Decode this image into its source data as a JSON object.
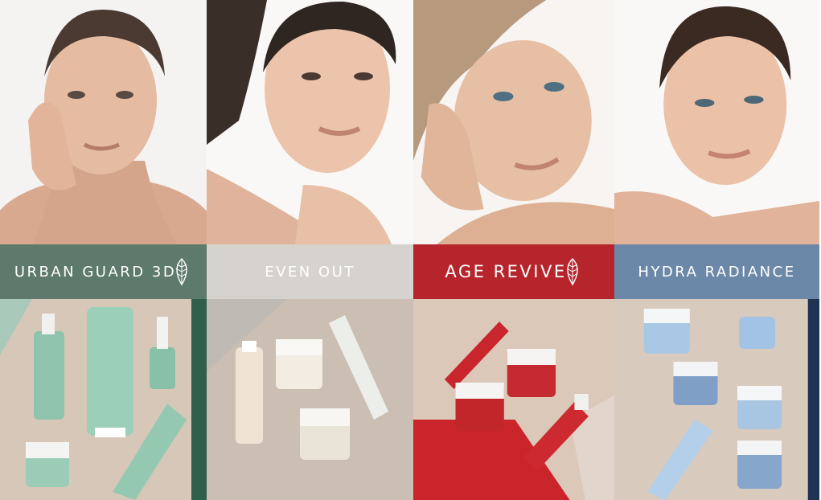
{
  "panels": [
    {
      "name": "urban-guard-3d",
      "title": "URBAN GUARD 3D",
      "banner_color": "#5e7a6d",
      "leaf_icon": "leaf-icon"
    },
    {
      "name": "even-out",
      "title": "EVEN OUT",
      "banner_color": "#d6d3cf",
      "leaf_icon": ""
    },
    {
      "name": "age-revive",
      "title": "AGE REVIVE",
      "banner_color": "#b7252c",
      "leaf_icon": "leaf-icon"
    },
    {
      "name": "hydra-radiance",
      "title": "HYDRA RADIANCE",
      "banner_color": "#6c88a8",
      "leaf_icon": ""
    }
  ]
}
